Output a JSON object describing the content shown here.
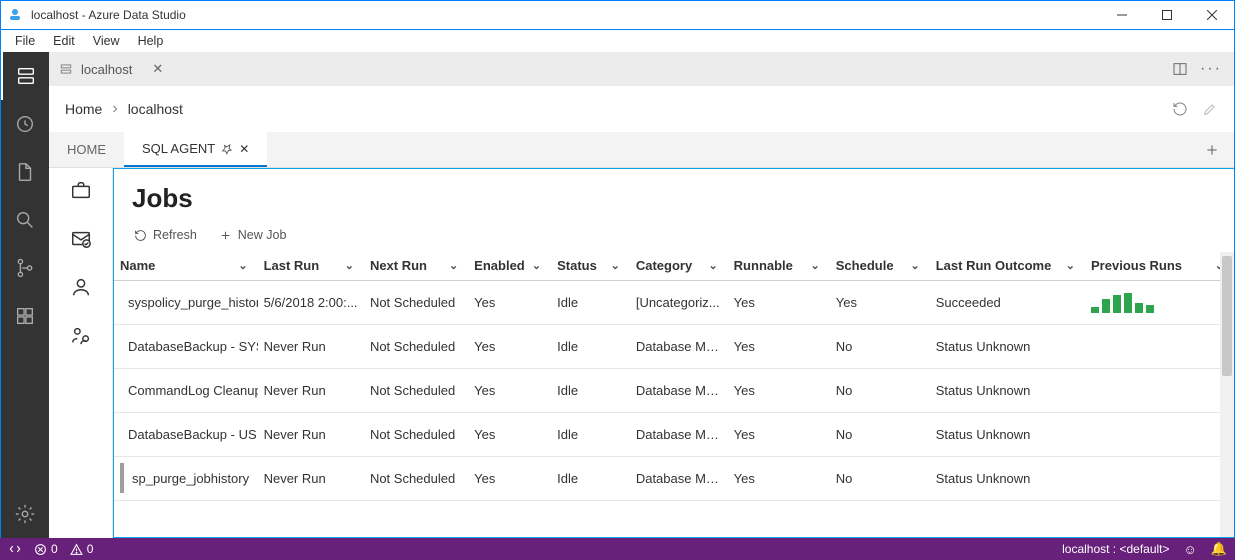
{
  "title": "localhost - Azure Data Studio",
  "menubar": [
    "File",
    "Edit",
    "View",
    "Help"
  ],
  "tab": {
    "label": "localhost"
  },
  "breadcrumb": {
    "home": "Home",
    "current": "localhost"
  },
  "dashtabs": {
    "home": "HOME",
    "sqlagent": "SQL AGENT"
  },
  "page": {
    "heading": "Jobs",
    "toolbar": {
      "refresh": "Refresh",
      "newjob": "New Job"
    }
  },
  "columns": {
    "name": "Name",
    "lastrun": "Last Run",
    "nextrun": "Next Run",
    "enabled": "Enabled",
    "status": "Status",
    "category": "Category",
    "runnable": "Runnable",
    "schedule": "Schedule",
    "outcome": "Last Run Outcome",
    "previous": "Previous Runs"
  },
  "rows": [
    {
      "color": "green",
      "name": "syspolicy_purge_history",
      "lastrun": "5/6/2018 2:00:...",
      "nextrun": "Not Scheduled",
      "enabled": "Yes",
      "status": "Idle",
      "category": "[Uncategoriz...",
      "runnable": "Yes",
      "schedule": "Yes",
      "outcome": "Succeeded"
    },
    {
      "color": "gray",
      "name": "DatabaseBackup - SYS",
      "lastrun": "Never Run",
      "nextrun": "Not Scheduled",
      "enabled": "Yes",
      "status": "Idle",
      "category": "Database Mai...",
      "runnable": "Yes",
      "schedule": "No",
      "outcome": "Status Unknown"
    },
    {
      "color": "gray",
      "name": "CommandLog Cleanup",
      "lastrun": "Never Run",
      "nextrun": "Not Scheduled",
      "enabled": "Yes",
      "status": "Idle",
      "category": "Database Mai...",
      "runnable": "Yes",
      "schedule": "No",
      "outcome": "Status Unknown"
    },
    {
      "color": "gray",
      "name": "DatabaseBackup - US",
      "lastrun": "Never Run",
      "nextrun": "Not Scheduled",
      "enabled": "Yes",
      "status": "Idle",
      "category": "Database Mai...",
      "runnable": "Yes",
      "schedule": "No",
      "outcome": "Status Unknown"
    },
    {
      "color": "gray",
      "name": "sp_purge_jobhistory",
      "lastrun": "Never Run",
      "nextrun": "Not Scheduled",
      "enabled": "Yes",
      "status": "Idle",
      "category": "Database Mai...",
      "runnable": "Yes",
      "schedule": "No",
      "outcome": "Status Unknown"
    }
  ],
  "statusbar": {
    "errors": "0",
    "warnings": "0",
    "conn": "localhost : <default>"
  }
}
